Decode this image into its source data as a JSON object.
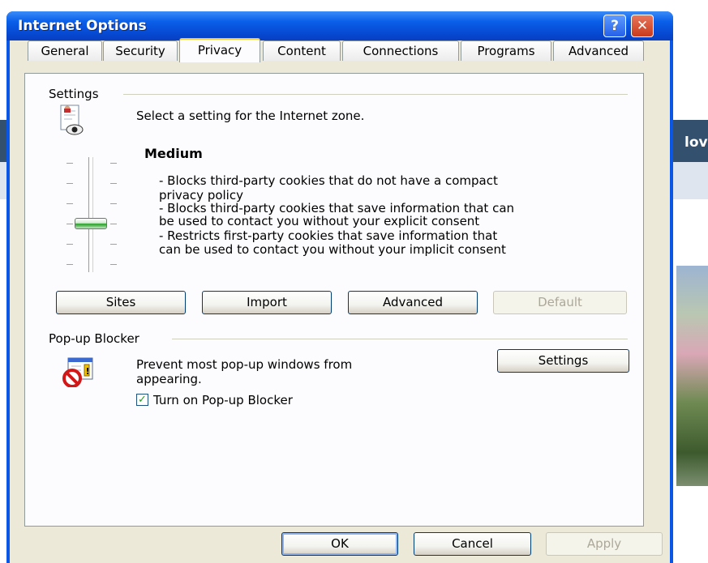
{
  "window": {
    "title": "Internet Options",
    "help_glyph": "?",
    "close_glyph": "✕"
  },
  "background": {
    "band_text": "lov"
  },
  "tabs": [
    {
      "label": "General"
    },
    {
      "label": "Security"
    },
    {
      "label": "Privacy"
    },
    {
      "label": "Content"
    },
    {
      "label": "Connections"
    },
    {
      "label": "Programs"
    },
    {
      "label": "Advanced"
    }
  ],
  "active_tab": "Privacy",
  "settings": {
    "group_label": "Settings",
    "zone_text": "Select a setting for the Internet zone.",
    "level": "Medium",
    "description_lines": [
      "- Blocks third-party cookies that do not have a compact",
      "privacy policy",
      "- Blocks third-party cookies that save information that can",
      "be used to contact you without your explicit consent",
      "- Restricts first-party cookies that save information that",
      "can be used to contact you without your implicit consent"
    ],
    "slider_level": 2,
    "slider_levels": 6,
    "buttons": {
      "sites": "Sites",
      "import": "Import",
      "advanced": "Advanced",
      "default": "Default"
    }
  },
  "popup": {
    "group_label": "Pop-up Blocker",
    "text_line1": "Prevent most pop-up windows from",
    "text_line2": "appearing.",
    "settings_button": "Settings",
    "checkbox_label": "Turn on Pop-up Blocker",
    "checkbox_checked": true,
    "check_glyph": "✓"
  },
  "footer": {
    "ok": "OK",
    "cancel": "Cancel",
    "apply": "Apply"
  },
  "colors": {
    "title_blue": "#0a56e6",
    "dialog_face": "#ece9d8",
    "tab_highlight": "#ffc83c",
    "slider_green": "#21a121"
  }
}
